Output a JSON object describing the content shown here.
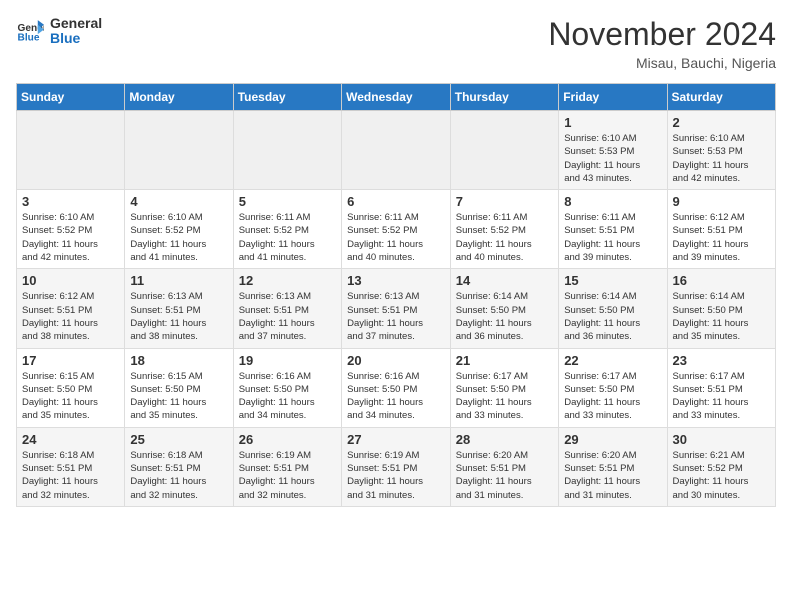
{
  "header": {
    "logo_line1": "General",
    "logo_line2": "Blue",
    "month": "November 2024",
    "location": "Misau, Bauchi, Nigeria"
  },
  "weekdays": [
    "Sunday",
    "Monday",
    "Tuesday",
    "Wednesday",
    "Thursday",
    "Friday",
    "Saturday"
  ],
  "weeks": [
    [
      {
        "day": "",
        "info": ""
      },
      {
        "day": "",
        "info": ""
      },
      {
        "day": "",
        "info": ""
      },
      {
        "day": "",
        "info": ""
      },
      {
        "day": "",
        "info": ""
      },
      {
        "day": "1",
        "info": "Sunrise: 6:10 AM\nSunset: 5:53 PM\nDaylight: 11 hours\nand 43 minutes."
      },
      {
        "day": "2",
        "info": "Sunrise: 6:10 AM\nSunset: 5:53 PM\nDaylight: 11 hours\nand 42 minutes."
      }
    ],
    [
      {
        "day": "3",
        "info": "Sunrise: 6:10 AM\nSunset: 5:52 PM\nDaylight: 11 hours\nand 42 minutes."
      },
      {
        "day": "4",
        "info": "Sunrise: 6:10 AM\nSunset: 5:52 PM\nDaylight: 11 hours\nand 41 minutes."
      },
      {
        "day": "5",
        "info": "Sunrise: 6:11 AM\nSunset: 5:52 PM\nDaylight: 11 hours\nand 41 minutes."
      },
      {
        "day": "6",
        "info": "Sunrise: 6:11 AM\nSunset: 5:52 PM\nDaylight: 11 hours\nand 40 minutes."
      },
      {
        "day": "7",
        "info": "Sunrise: 6:11 AM\nSunset: 5:52 PM\nDaylight: 11 hours\nand 40 minutes."
      },
      {
        "day": "8",
        "info": "Sunrise: 6:11 AM\nSunset: 5:51 PM\nDaylight: 11 hours\nand 39 minutes."
      },
      {
        "day": "9",
        "info": "Sunrise: 6:12 AM\nSunset: 5:51 PM\nDaylight: 11 hours\nand 39 minutes."
      }
    ],
    [
      {
        "day": "10",
        "info": "Sunrise: 6:12 AM\nSunset: 5:51 PM\nDaylight: 11 hours\nand 38 minutes."
      },
      {
        "day": "11",
        "info": "Sunrise: 6:13 AM\nSunset: 5:51 PM\nDaylight: 11 hours\nand 38 minutes."
      },
      {
        "day": "12",
        "info": "Sunrise: 6:13 AM\nSunset: 5:51 PM\nDaylight: 11 hours\nand 37 minutes."
      },
      {
        "day": "13",
        "info": "Sunrise: 6:13 AM\nSunset: 5:51 PM\nDaylight: 11 hours\nand 37 minutes."
      },
      {
        "day": "14",
        "info": "Sunrise: 6:14 AM\nSunset: 5:50 PM\nDaylight: 11 hours\nand 36 minutes."
      },
      {
        "day": "15",
        "info": "Sunrise: 6:14 AM\nSunset: 5:50 PM\nDaylight: 11 hours\nand 36 minutes."
      },
      {
        "day": "16",
        "info": "Sunrise: 6:14 AM\nSunset: 5:50 PM\nDaylight: 11 hours\nand 35 minutes."
      }
    ],
    [
      {
        "day": "17",
        "info": "Sunrise: 6:15 AM\nSunset: 5:50 PM\nDaylight: 11 hours\nand 35 minutes."
      },
      {
        "day": "18",
        "info": "Sunrise: 6:15 AM\nSunset: 5:50 PM\nDaylight: 11 hours\nand 35 minutes."
      },
      {
        "day": "19",
        "info": "Sunrise: 6:16 AM\nSunset: 5:50 PM\nDaylight: 11 hours\nand 34 minutes."
      },
      {
        "day": "20",
        "info": "Sunrise: 6:16 AM\nSunset: 5:50 PM\nDaylight: 11 hours\nand 34 minutes."
      },
      {
        "day": "21",
        "info": "Sunrise: 6:17 AM\nSunset: 5:50 PM\nDaylight: 11 hours\nand 33 minutes."
      },
      {
        "day": "22",
        "info": "Sunrise: 6:17 AM\nSunset: 5:50 PM\nDaylight: 11 hours\nand 33 minutes."
      },
      {
        "day": "23",
        "info": "Sunrise: 6:17 AM\nSunset: 5:51 PM\nDaylight: 11 hours\nand 33 minutes."
      }
    ],
    [
      {
        "day": "24",
        "info": "Sunrise: 6:18 AM\nSunset: 5:51 PM\nDaylight: 11 hours\nand 32 minutes."
      },
      {
        "day": "25",
        "info": "Sunrise: 6:18 AM\nSunset: 5:51 PM\nDaylight: 11 hours\nand 32 minutes."
      },
      {
        "day": "26",
        "info": "Sunrise: 6:19 AM\nSunset: 5:51 PM\nDaylight: 11 hours\nand 32 minutes."
      },
      {
        "day": "27",
        "info": "Sunrise: 6:19 AM\nSunset: 5:51 PM\nDaylight: 11 hours\nand 31 minutes."
      },
      {
        "day": "28",
        "info": "Sunrise: 6:20 AM\nSunset: 5:51 PM\nDaylight: 11 hours\nand 31 minutes."
      },
      {
        "day": "29",
        "info": "Sunrise: 6:20 AM\nSunset: 5:51 PM\nDaylight: 11 hours\nand 31 minutes."
      },
      {
        "day": "30",
        "info": "Sunrise: 6:21 AM\nSunset: 5:52 PM\nDaylight: 11 hours\nand 30 minutes."
      }
    ]
  ]
}
